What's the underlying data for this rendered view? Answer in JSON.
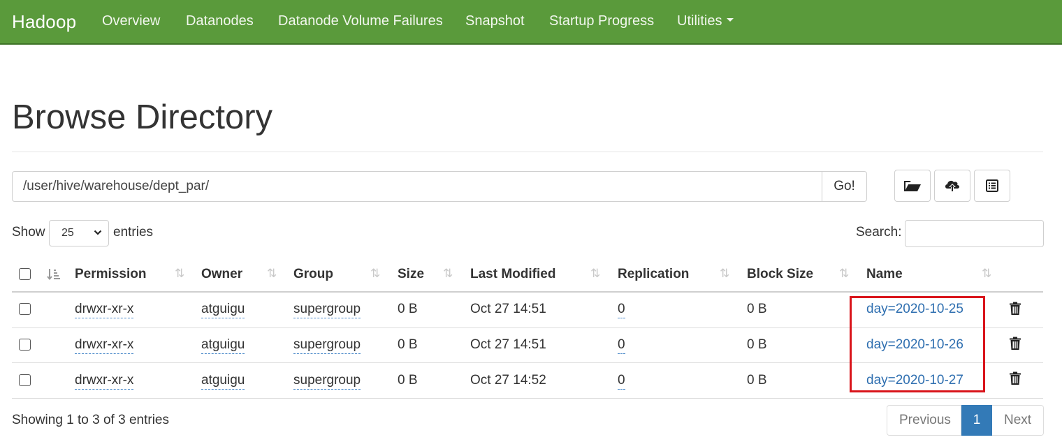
{
  "navbar": {
    "brand": "Hadoop",
    "items": [
      "Overview",
      "Datanodes",
      "Datanode Volume Failures",
      "Snapshot",
      "Startup Progress",
      "Utilities"
    ]
  },
  "page": {
    "title": "Browse Directory",
    "path_value": "/user/hive/warehouse/dept_par/",
    "go_label": "Go!"
  },
  "toolbar": {
    "icons": [
      "folder-open-icon",
      "cloud-upload-icon",
      "list-alt-icon"
    ]
  },
  "controls": {
    "show_label": "Show",
    "entries_value": "25",
    "entries_label": "entries",
    "search_label": "Search:"
  },
  "table": {
    "headers": [
      "Permission",
      "Owner",
      "Group",
      "Size",
      "Last Modified",
      "Replication",
      "Block Size",
      "Name"
    ],
    "rows": [
      {
        "permission": "drwxr-xr-x",
        "owner": "atguigu",
        "group": "supergroup",
        "size": "0 B",
        "modified": "Oct 27 14:51",
        "replication": "0",
        "block_size": "0 B",
        "name": "day=2020-10-25"
      },
      {
        "permission": "drwxr-xr-x",
        "owner": "atguigu",
        "group": "supergroup",
        "size": "0 B",
        "modified": "Oct 27 14:51",
        "replication": "0",
        "block_size": "0 B",
        "name": "day=2020-10-26"
      },
      {
        "permission": "drwxr-xr-x",
        "owner": "atguigu",
        "group": "supergroup",
        "size": "0 B",
        "modified": "Oct 27 14:52",
        "replication": "0",
        "block_size": "0 B",
        "name": "day=2020-10-27"
      }
    ]
  },
  "footer": {
    "info": "Showing 1 to 3 of 3 entries",
    "previous": "Previous",
    "page": "1",
    "next": "Next"
  },
  "colors": {
    "navbar": "#5a9a3b",
    "link": "#2f6fb0",
    "active_page": "#337ab7",
    "highlight": "#d9141b"
  }
}
